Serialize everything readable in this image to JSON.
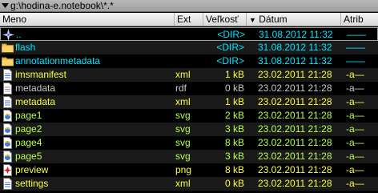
{
  "path": "g:\\hodina-e.notebook\\*.*",
  "columns": {
    "name": "Meno",
    "ext": "Ext",
    "size": "Veľkosť",
    "date": "Dátum",
    "attr": "Atrib",
    "sort_indicator": "▼"
  },
  "rows": [
    {
      "name": "..",
      "ext": "",
      "size": "<DIR>",
      "date": "31.08.2012 11:32",
      "attr": "——",
      "icon": "up-icon",
      "kind": "folder"
    },
    {
      "name": "flash",
      "ext": "",
      "size": "<DIR>",
      "date": "31.08.2012 11:32",
      "attr": "——",
      "icon": "folder-icon",
      "kind": "folder"
    },
    {
      "name": "annotationmetadata",
      "ext": "",
      "size": "<DIR>",
      "date": "31.08.2012 11:32",
      "attr": "——",
      "icon": "folder-icon",
      "kind": "folder"
    },
    {
      "name": "imsmanifest",
      "ext": "xml",
      "size": "1 kB",
      "date": "23.02.2011 21:28",
      "attr": "-a—",
      "icon": "xml-file-icon",
      "kind": "file"
    },
    {
      "name": "metadata",
      "ext": "rdf",
      "size": "0 kB",
      "date": "23.02.2011 21:28",
      "attr": "-a—",
      "icon": "document-icon",
      "kind": "rdf"
    },
    {
      "name": "metadata",
      "ext": "xml",
      "size": "1 kB",
      "date": "23.02.2011 21:28",
      "attr": "-a—",
      "icon": "xml-file-icon",
      "kind": "file"
    },
    {
      "name": "page1",
      "ext": "svg",
      "size": "2 kB",
      "date": "23.02.2011 21:28",
      "attr": "-a—",
      "icon": "browser-file-icon",
      "kind": "svg"
    },
    {
      "name": "page2",
      "ext": "svg",
      "size": "3 kB",
      "date": "23.02.2011 21:28",
      "attr": "-a—",
      "icon": "browser-file-icon",
      "kind": "svg"
    },
    {
      "name": "page4",
      "ext": "svg",
      "size": "8 kB",
      "date": "23.02.2011 21:28",
      "attr": "-a—",
      "icon": "browser-file-icon",
      "kind": "svg"
    },
    {
      "name": "page5",
      "ext": "svg",
      "size": "3 kB",
      "date": "23.02.2011 21:28",
      "attr": "-a—",
      "icon": "browser-file-icon",
      "kind": "svg"
    },
    {
      "name": "preview",
      "ext": "png",
      "size": "8 kB",
      "date": "23.02.2011 21:28",
      "attr": "-a—",
      "icon": "image-file-icon",
      "kind": "file"
    },
    {
      "name": "settings",
      "ext": "xml",
      "size": "0 kB",
      "date": "23.02.2011 21:28",
      "attr": "-a—",
      "icon": "xml-file-icon",
      "kind": "file"
    }
  ],
  "colors": {
    "folder": "#00e5ff",
    "file": "#ffff3c",
    "svg": "#b8ff4a",
    "rdf": "#c8c8c8",
    "background": "#000000"
  }
}
